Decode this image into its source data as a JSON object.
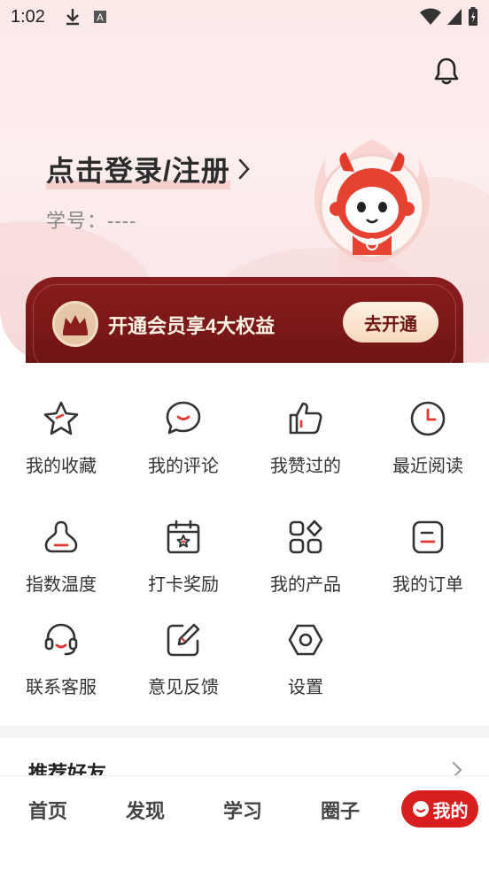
{
  "status_bar": {
    "time": "1:02"
  },
  "header": {
    "login_label": "点击登录/注册",
    "student_id_label": "学号：----"
  },
  "vip": {
    "text": "开通会员享4大权益",
    "button": "去开通"
  },
  "menu": [
    {
      "label": "我的收藏",
      "icon": "star-icon"
    },
    {
      "label": "我的评论",
      "icon": "comment-icon"
    },
    {
      "label": "我赞过的",
      "icon": "thumbs-up-icon"
    },
    {
      "label": "最近阅读",
      "icon": "clock-icon"
    },
    {
      "label": "指数温度",
      "icon": "bell-shape-icon"
    },
    {
      "label": "打卡奖励",
      "icon": "calendar-star-icon"
    },
    {
      "label": "我的产品",
      "icon": "apps-grid-icon"
    },
    {
      "label": "我的订单",
      "icon": "order-icon"
    },
    {
      "label": "联系客服",
      "icon": "headset-icon"
    },
    {
      "label": "意见反馈",
      "icon": "edit-icon"
    },
    {
      "label": "设置",
      "icon": "settings-icon"
    }
  ],
  "friends": {
    "title": "推荐好友"
  },
  "tabbar": {
    "tabs": [
      {
        "label": "首页"
      },
      {
        "label": "发现"
      },
      {
        "label": "学习"
      },
      {
        "label": "圈子"
      }
    ],
    "active": {
      "label": "我的"
    }
  },
  "colors": {
    "accent_red": "#d91e1e",
    "vip_dark_red": "#7a1818",
    "header_pink": "#fde8e8"
  }
}
